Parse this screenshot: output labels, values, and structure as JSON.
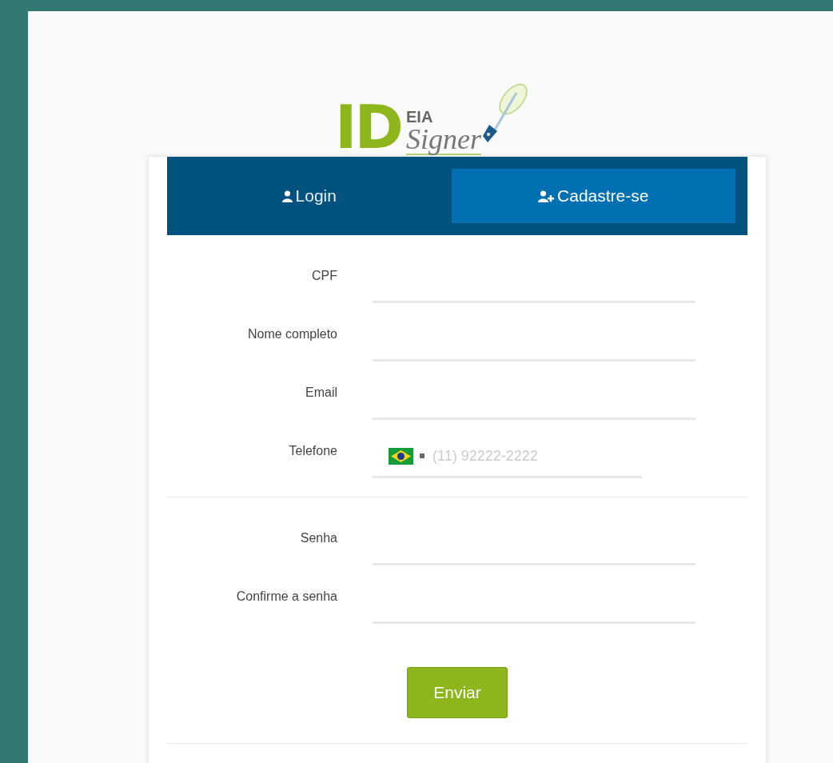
{
  "logo": {
    "mark": "ID",
    "top": "EIA",
    "bottom": "Signer"
  },
  "tabs": [
    {
      "label": "Login",
      "kind": "user",
      "selected": false
    },
    {
      "label": "Cadastre-se",
      "kind": "user-plus",
      "selected": true
    }
  ],
  "fields": [
    {
      "label": "CPF",
      "kind": "text"
    },
    {
      "label": "Nome completo",
      "kind": "text"
    },
    {
      "label": "Email",
      "kind": "text"
    },
    {
      "label": "Telefone",
      "kind": "phone",
      "placeholder": "(11) 92222-2222"
    }
  ],
  "password_fields": [
    {
      "label": "Senha",
      "kind": "text"
    },
    {
      "label": "Confirme a senha",
      "kind": "text"
    }
  ],
  "submit": "Enviar"
}
